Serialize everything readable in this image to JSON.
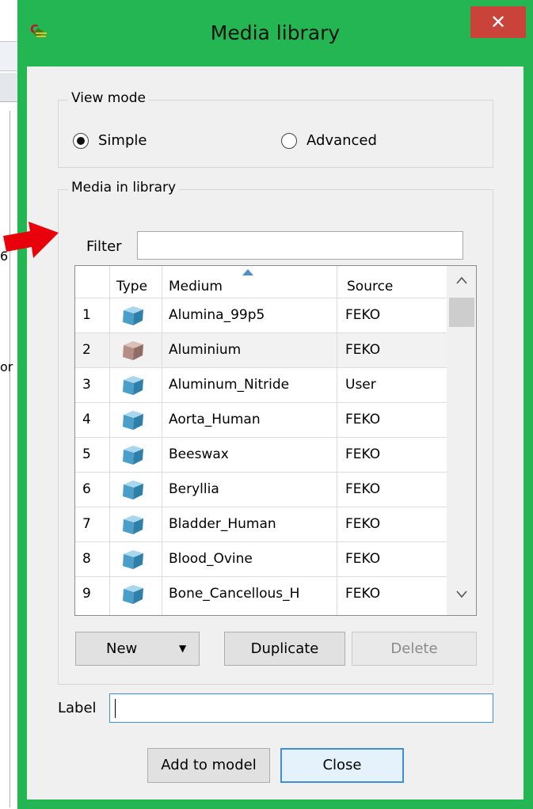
{
  "background_app": {
    "fragments": [
      "6",
      "or"
    ]
  },
  "window": {
    "title": "Media library",
    "close_glyph": "✕"
  },
  "view_mode": {
    "legend": "View mode",
    "options": [
      "Simple",
      "Advanced"
    ],
    "selected": "Simple"
  },
  "media": {
    "legend": "Media in library",
    "filter_label": "Filter",
    "filter_value": "",
    "columns": {
      "index": "",
      "type": "Type",
      "medium": "Medium",
      "source": "Source"
    },
    "rows": [
      {
        "index": "1",
        "medium": "Alumina_99p5",
        "source": "FEKO",
        "icon": "dielectric-cube-icon",
        "icon_color": "#4a9ec8"
      },
      {
        "index": "2",
        "medium": "Aluminium",
        "source": "FEKO",
        "icon": "metal-cube-icon",
        "icon_color": "#b58d84"
      },
      {
        "index": "3",
        "medium": "Aluminum_Nitride",
        "source": "User",
        "icon": "dielectric-cube-icon",
        "icon_color": "#4a9ec8"
      },
      {
        "index": "4",
        "medium": "Aorta_Human",
        "source": "FEKO",
        "icon": "dielectric-cube-icon",
        "icon_color": "#4a9ec8"
      },
      {
        "index": "5",
        "medium": "Beeswax",
        "source": "FEKO",
        "icon": "dielectric-cube-icon",
        "icon_color": "#4a9ec8"
      },
      {
        "index": "6",
        "medium": "Beryllia",
        "source": "FEKO",
        "icon": "dielectric-cube-icon",
        "icon_color": "#4a9ec8"
      },
      {
        "index": "7",
        "medium": "Bladder_Human",
        "source": "FEKO",
        "icon": "dielectric-cube-icon",
        "icon_color": "#4a9ec8"
      },
      {
        "index": "8",
        "medium": "Blood_Ovine",
        "source": "FEKO",
        "icon": "dielectric-cube-icon",
        "icon_color": "#4a9ec8"
      },
      {
        "index": "9",
        "medium": "Bone_Cancellous_H",
        "source": "FEKO",
        "icon": "dielectric-cube-icon",
        "icon_color": "#4a9ec8"
      }
    ],
    "highlighted_row": "2",
    "scroll_up": "^",
    "scroll_down": "v",
    "buttons": {
      "new": "New",
      "new_arrow": "▼",
      "duplicate": "Duplicate",
      "delete": "Delete"
    }
  },
  "label": {
    "label": "Label",
    "value": ""
  },
  "footer": {
    "add": "Add to model",
    "close": "Close"
  },
  "colors": {
    "window_border": "#25b654",
    "close_button": "#c9433b",
    "client_bg": "#f0f0f0",
    "focus_blue": "#3c8fd8",
    "arrow_red": "#e8000a"
  }
}
